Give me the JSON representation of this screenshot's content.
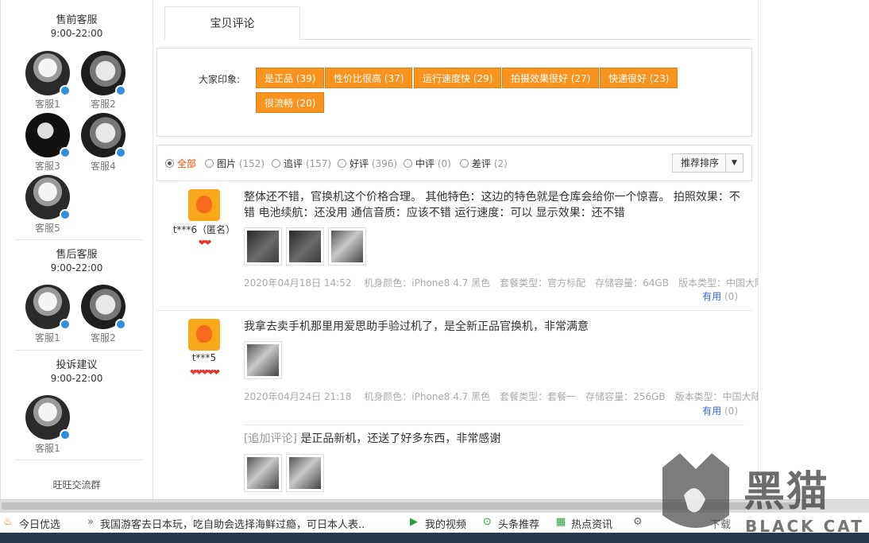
{
  "sidebar": {
    "presale": {
      "title": "售前客服",
      "hours": "9:00-22:00",
      "agents": [
        "客服1",
        "客服2",
        "客服3",
        "客服4",
        "客服5"
      ]
    },
    "aftersale": {
      "title": "售后客服",
      "hours": "9:00-22:00",
      "agents": [
        "客服1",
        "客服2"
      ]
    },
    "complaint": {
      "title": "投诉建议",
      "hours": "9:00-22:00",
      "agents": [
        "客服1"
      ]
    },
    "wangwang": "旺旺交流群"
  },
  "tab": {
    "label": "宝贝评论"
  },
  "impressions": {
    "label": "大家印象:",
    "tags": [
      "是正品 (39)",
      "性价比很高 (37)",
      "运行速度快 (29)",
      "拍摄效果很好 (27)",
      "快递很好 (23)",
      "很流畅 (20)"
    ]
  },
  "filters": [
    {
      "label": "全部",
      "count": ""
    },
    {
      "label": "图片",
      "count": "(152)"
    },
    {
      "label": "追评",
      "count": "(157)"
    },
    {
      "label": "好评",
      "count": "(396)"
    },
    {
      "label": "中评",
      "count": "(0)"
    },
    {
      "label": "差评",
      "count": "(2)"
    }
  ],
  "sort": {
    "label": "推荐排序",
    "caret": "▼"
  },
  "reviews": [
    {
      "user": "t***6（匿名）",
      "hearts": "❤❤",
      "text": "整体还不错，官换机这个价格合理。 其他特色：这边的特色就是仓库会给你一个惊喜。 拍照效果：不错 电池续航：还没用 通信音质：应该不错 运行速度：可以 显示效果：还不错",
      "meta": "2020年04月18日 14:52　 机身颜色：iPhone8 4.7 黑色　套餐类型：官方标配　存储容量：64GB　版本类型：中国大陆",
      "useful": "有用",
      "useful_count": "(0)"
    },
    {
      "user": "t***5",
      "hearts": "❤❤❤❤❤",
      "text": "我拿去卖手机那里用爱思助手验过机了，是全新正品官换机，非常满意",
      "meta": "2020年04月24日 21:18　 机身颜色：iPhone8 4.7 黑色　套餐类型：套餐一　存储容量：256GB　版本类型：中国大陆",
      "useful": "有用",
      "useful_count": "(0)",
      "append_label": "[追加评论]",
      "append_text": "是正品新机，还送了好多东西，非常感谢"
    }
  ],
  "newsbar": {
    "today": "今日优选",
    "headline": "我国游客去日本玩，吃自助会选择海鲜过瘾，可日本人表..",
    "my_video": "我的视频",
    "top_recommend": "头条推荐",
    "hot_news": "热点资讯",
    "download": "下载"
  },
  "watermark": {
    "cn": "黑猫",
    "en": "BLACK CAT"
  },
  "colors": {
    "accent": "#f7931e",
    "link": "#3366cc",
    "active_filter": "#ff4400"
  }
}
